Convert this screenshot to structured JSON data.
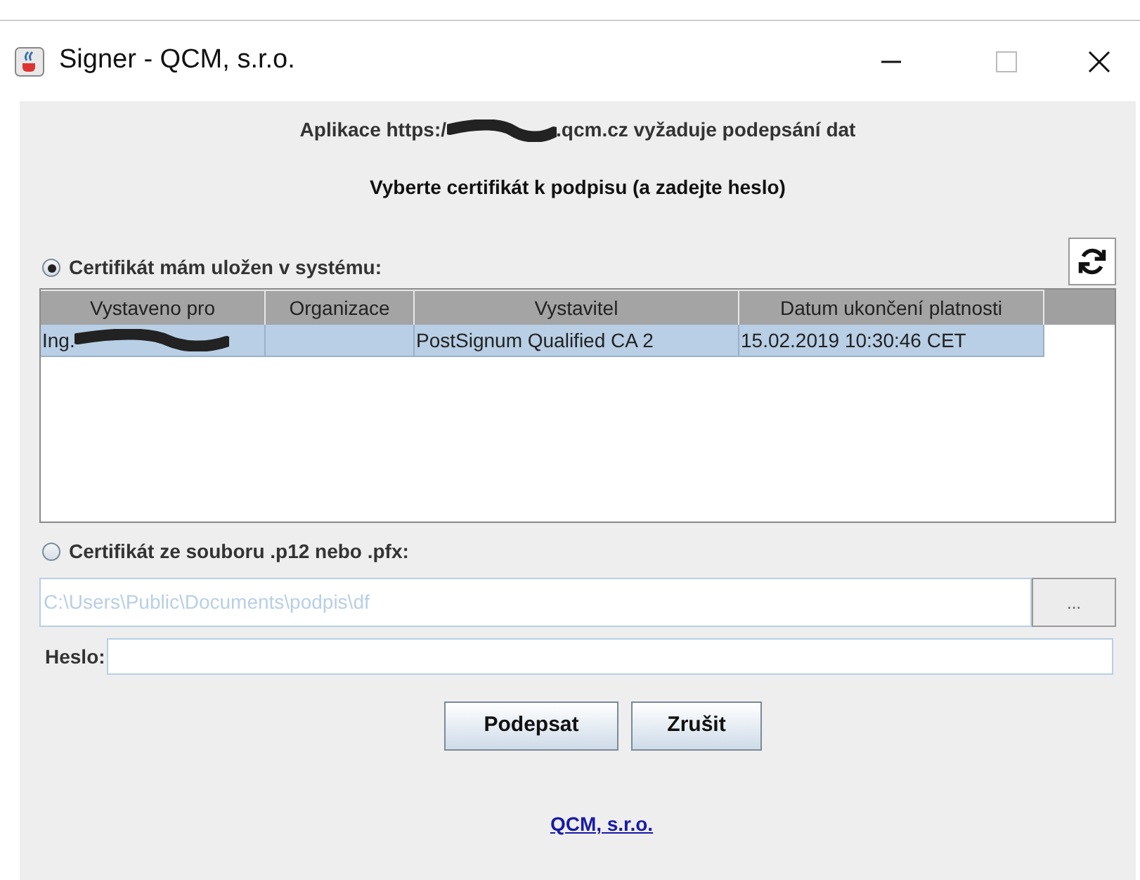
{
  "window": {
    "title": "Signer - QCM, s.r.o."
  },
  "message": {
    "before": "Aplikace https:/",
    "after": ".qcm.cz vyžaduje podepsání dat"
  },
  "heading": "Vyberte certifikát k podpisu (a zadejte heslo)",
  "system_option": {
    "label": "Certifikát mám uložen v systému:",
    "selected": true
  },
  "table": {
    "columns": [
      "Vystaveno pro",
      "Organizace",
      "Vystavitel",
      "Datum ukončení platnosti"
    ],
    "rows": [
      {
        "cells": [
          "Ing.",
          "",
          "PostSignum Qualified CA 2",
          "15.02.2019 10:30:46 CET"
        ],
        "redacted_first": true,
        "selected": true
      }
    ]
  },
  "file_option": {
    "label": "Certifikát ze souboru .p12 nebo .pfx:",
    "selected": false
  },
  "file_field": {
    "value": "C:\\Users\\Public\\Documents\\podpis\\df",
    "disabled": true
  },
  "browse_button": "...",
  "password": {
    "label": "Heslo:"
  },
  "buttons": [
    "Podepsat",
    "Zrušit"
  ],
  "link": "QCM, s.r.o."
}
